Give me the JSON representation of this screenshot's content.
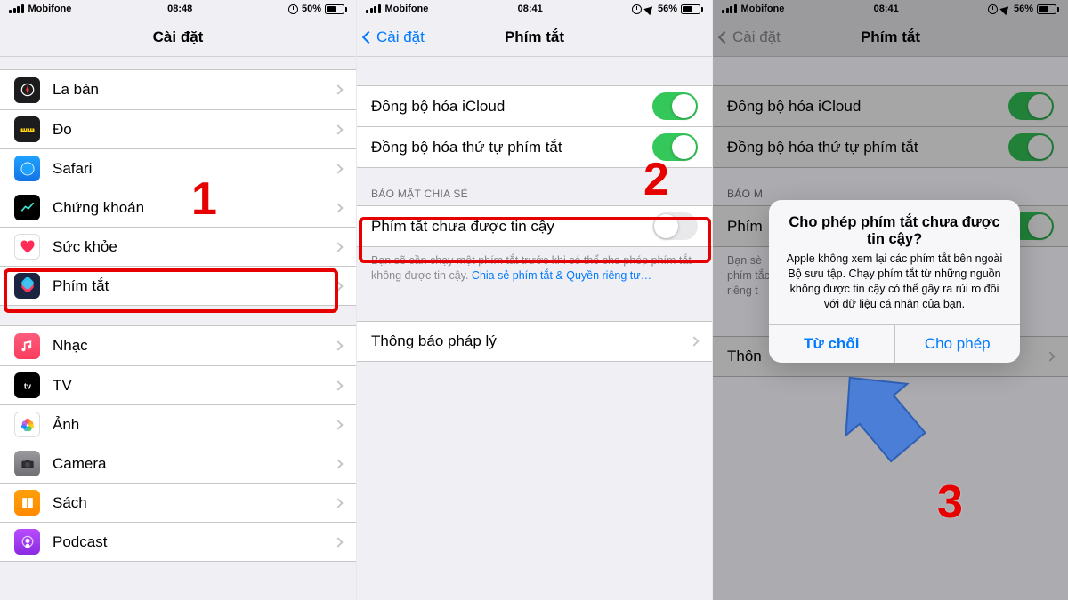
{
  "screens": [
    {
      "status": {
        "carrier": "Mobifone",
        "time": "08:48",
        "battery_pct": "50%",
        "battery_fill": 50,
        "show_alarm": true,
        "show_location": false
      },
      "nav_title": "Cài đặt",
      "apps": [
        {
          "key": "compass",
          "label": "La bàn"
        },
        {
          "key": "measure",
          "label": "Đo"
        },
        {
          "key": "safari",
          "label": "Safari"
        },
        {
          "key": "stocks",
          "label": "Chứng khoán"
        },
        {
          "key": "health",
          "label": "Sức khỏe"
        },
        {
          "key": "shortcuts",
          "label": "Phím tắt"
        }
      ],
      "apps2": [
        {
          "key": "music",
          "label": "Nhạc"
        },
        {
          "key": "tv",
          "label": "TV"
        },
        {
          "key": "photos",
          "label": "Ảnh"
        },
        {
          "key": "camera",
          "label": "Camera"
        },
        {
          "key": "books",
          "label": "Sách"
        },
        {
          "key": "podcast",
          "label": "Podcast"
        }
      ],
      "step": "1"
    },
    {
      "status": {
        "carrier": "Mobifone",
        "time": "08:41",
        "battery_pct": "56%",
        "battery_fill": 56,
        "show_alarm": true,
        "show_location": true
      },
      "nav_back": "Cài đặt",
      "nav_title": "Phím tắt",
      "rows": {
        "icloud": "Đồng bộ hóa iCloud",
        "order": "Đồng bộ hóa thứ tự phím tắt",
        "sec_header": "BẢO MẬT CHIA SẺ",
        "untrusted": "Phím tắt chưa được tin cậy",
        "footer_a": "Bạn sẽ cần chạy một phím tắt trước khi có thể cho phép phím tắt không được tin cậy. ",
        "footer_link": "Chia sẻ phím tắt & Quyền riêng tư…",
        "legal": "Thông báo pháp lý"
      },
      "step": "2"
    },
    {
      "status": {
        "carrier": "Mobifone",
        "time": "08:41",
        "battery_pct": "56%",
        "battery_fill": 56,
        "show_alarm": true,
        "show_location": true
      },
      "nav_back": "Cài đặt",
      "nav_title": "Phím tắt",
      "rows": {
        "icloud": "Đồng bộ hóa iCloud",
        "order": "Đồng bộ hóa thứ tự phím tắt",
        "sec_header": "BẢO M",
        "untrusted": "Phím",
        "footer_a": "Bạn sè\nphím tắc\nriêng t",
        "legal": "Thôn"
      },
      "alert": {
        "title": "Cho phép phím tắt chưa được tin cậy?",
        "message": "Apple không xem lại các phím tắt bên ngoài Bộ sưu tập. Chạy phím tắt từ những nguồn không được tin cậy có thể gây ra rủi ro đối với dữ liệu cá nhân của bạn.",
        "deny": "Từ chối",
        "allow": "Cho phép"
      },
      "step": "3"
    }
  ]
}
